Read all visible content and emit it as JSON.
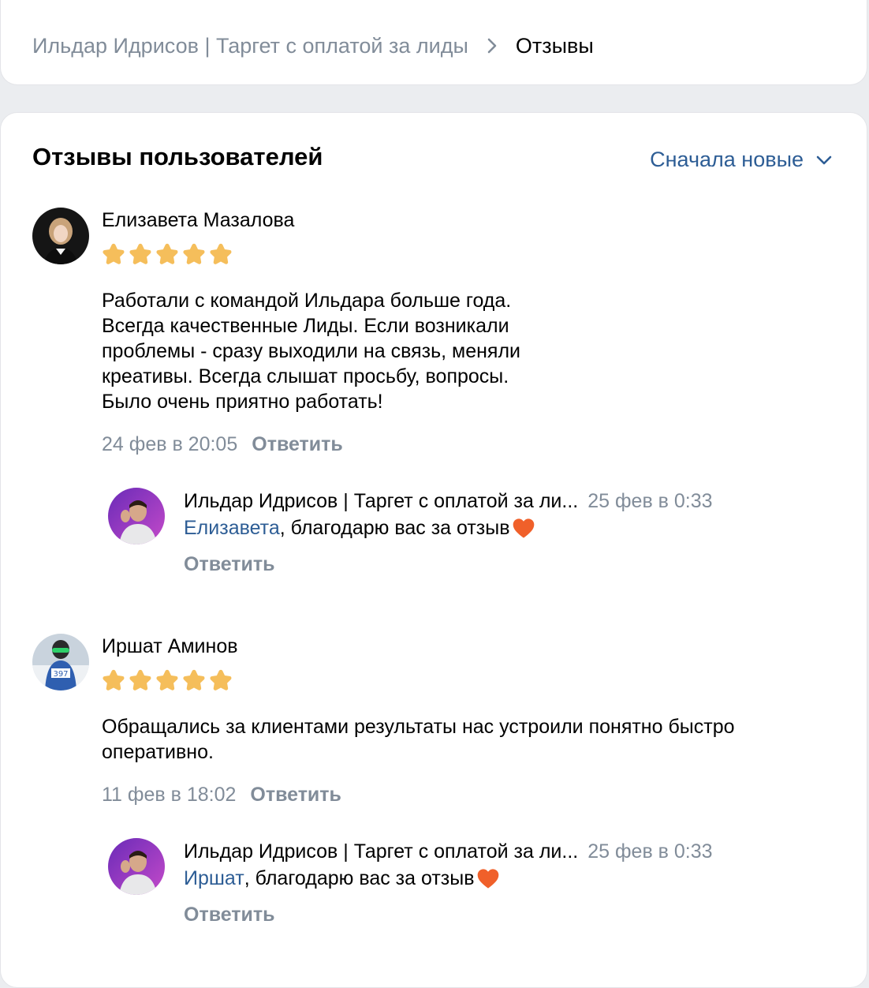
{
  "breadcrumb": {
    "group": "Ильдар Идрисов | Таргет с оплатой за лиды",
    "current": "Отзывы"
  },
  "section": {
    "title": "Отзывы пользователей",
    "sort_label": "Сначала новые"
  },
  "colors": {
    "link": "#2d5d95",
    "secondary": "#818c99",
    "star": "#f5be5b",
    "heart": "#f0602a"
  },
  "reviews": [
    {
      "author": "Елизавета Мазалова",
      "rating": 5,
      "text": "Работали с командой Ильдара больше года.\nВсегда качественные Лиды. Если возникали\nпроблемы - сразу выходили на связь, меняли\nкреативы. Всегда слышат просьбу, вопросы.\nБыло очень приятно работать!",
      "date": "24 фев в 20:05",
      "reply_label": "Ответить",
      "reply": {
        "author": "Ильдар Идрисов | Таргет с оплатой за ли...",
        "date": "25 фев в 0:33",
        "mention": "Елизавета",
        "text": ", благодарю вас за отзыв",
        "reply_label": "Ответить"
      }
    },
    {
      "author": "Иршат Аминов",
      "rating": 5,
      "text": "Обращались за клиентами результаты нас устроили понятно быстро\nоперативно.",
      "date": "11 фев в 18:02",
      "reply_label": "Ответить",
      "reply": {
        "author": "Ильдар Идрисов | Таргет с оплатой за ли...",
        "date": "25 фев в 0:33",
        "mention": "Иршат",
        "text": ", благодарю вас за отзыв",
        "reply_label": "Ответить"
      }
    }
  ]
}
